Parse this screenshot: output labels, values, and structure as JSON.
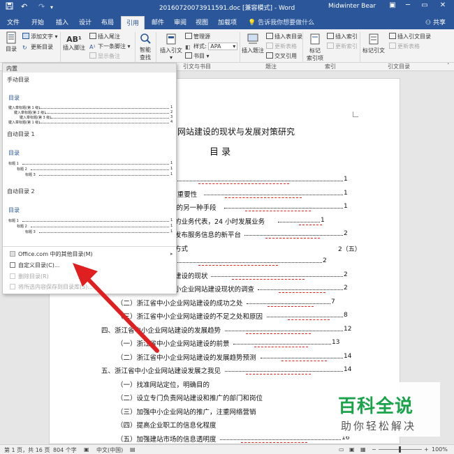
{
  "titlebar": {
    "title": "20160720073911591.doc [兼容模式] - Word",
    "user": "Midwinter Bear",
    "save_icon": "save-icon",
    "undo": "↶",
    "redo": "↷",
    "min": "─",
    "restore": "▭",
    "close": "✕",
    "options": "▣"
  },
  "tabs": [
    "文件",
    "开始",
    "插入",
    "设计",
    "布局",
    "引用",
    "邮件",
    "审阅",
    "视图",
    "加载项"
  ],
  "active_tab": "引用",
  "tellme": "告诉我你想要做什么",
  "share": "共享",
  "ribbon": {
    "toc": "目录",
    "add_text": "添加文字",
    "update_toc": "更新目录",
    "insert_footnote": "插入脚注",
    "insert_endnote": "插入尾注",
    "next_footnote": "下一条脚注",
    "show_notes": "显示备注",
    "smart_lookup_1": "智能",
    "smart_lookup_2": "查找",
    "insert_citation": "插入引文",
    "manage_sources": "管理源",
    "style": "样式:",
    "style_value": "APA",
    "bibliography": "书目",
    "insert_caption": "插入题注",
    "insert_table_of_figures": "插入表目录",
    "update_table": "更新表格",
    "cross_reference": "交叉引用",
    "mark_entry_1": "标记",
    "mark_entry_2": "索引项",
    "insert_index": "插入索引",
    "update_index": "更新索引",
    "mark_citation": "标记引文",
    "insert_table_of_authorities": "插入引文目录",
    "update_table_2": "更新表格",
    "group_citations": "引文与书目",
    "group_captions": "题注",
    "group_index": "索引",
    "group_authorities": "引文目录",
    "ab_icon": "AB¹"
  },
  "toc_panel": {
    "builtin": "内置",
    "manual_label": "手动目录",
    "manual_title": "目录",
    "manual_entries": [
      "键入章标题(第 1 级)",
      "键入章标题(第 2 级)",
      "键入章标题(第 3 级)",
      "键入章标题(第 1 级)"
    ],
    "manual_pages": [
      "1",
      "2",
      "3",
      "4"
    ],
    "auto1_label": "自动目录 1",
    "auto1_title": "目录",
    "auto2_label": "自动目录 2",
    "auto2_title": "目录",
    "auto_entries": [
      "标题 1",
      "标题 2",
      "标题 3"
    ],
    "auto_pages": [
      "1",
      "1",
      "1"
    ],
    "menu_more": "Office.com 中的其他目录(M)",
    "menu_custom": "自定义目录(C)...",
    "menu_remove": "删除目录(R)",
    "menu_save": "将所选内容保存到目录库(S)..."
  },
  "document": {
    "heading": "网站建设的现状与发展对策研究",
    "toc_title": "目  录",
    "lines": [
      {
        "text": "",
        "page": "1"
      },
      {
        "text": ")重要性",
        "page": "1"
      },
      {
        "text": "i的另一种手段",
        "page": "1"
      },
      {
        "text": "的业务代表，24 小时发展业务",
        "page": "1"
      },
      {
        "text": "发布服务信息的新平台",
        "page": "2"
      },
      {
        "text": "方式",
        "page": "2（五）"
      },
      {
        "text": "",
        "page": "2"
      },
      {
        "text": "建设的现状",
        "page": "2"
      },
      {
        "text": "小企业网站建设现状的调查",
        "page": "2"
      },
      {
        "text": "（二）浙江省中小企业网站建设的成功之处",
        "page": "7"
      },
      {
        "text": "（三）浙江省中小企业网站建设的不足之处和原因",
        "page": "8"
      },
      {
        "text": "四、浙江省中小企业网站建设的发展趋势",
        "page": "12"
      },
      {
        "text": "（一）浙江省中小企业网站建设的前景",
        "page": "13"
      },
      {
        "text": "（二）浙江省中小企业网站建设的发展趋势预测",
        "page": "14"
      },
      {
        "text": "五、浙江省中小企业网站建设发展之我见",
        "page": "14"
      },
      {
        "text": "（一）找准网站定位，明确目的",
        "page": ""
      },
      {
        "text": "（二）设立专门负责网站建设和推广的部门和岗位",
        "page": ""
      },
      {
        "text": "（三）加强中小企业网站的推广，注重网络营销",
        "page": ""
      },
      {
        "text": "（四）提高企业职工的信息化程度",
        "page": ""
      },
      {
        "text": "（五）加强建站市场的信息透明度",
        "page": "16"
      }
    ]
  },
  "statusbar": {
    "page": "第 1 页，共 16 页",
    "words": "804 个字",
    "lang": "中文(中国)",
    "zoom": "100%",
    "zoom_minus": "−",
    "zoom_plus": "+"
  },
  "watermark": {
    "line1": "百科全说",
    "line2": "助你轻松解决"
  },
  "colors": {
    "brand": "#2b579a",
    "arrow": "#e02020",
    "watermark_green": "#1aa34a"
  }
}
